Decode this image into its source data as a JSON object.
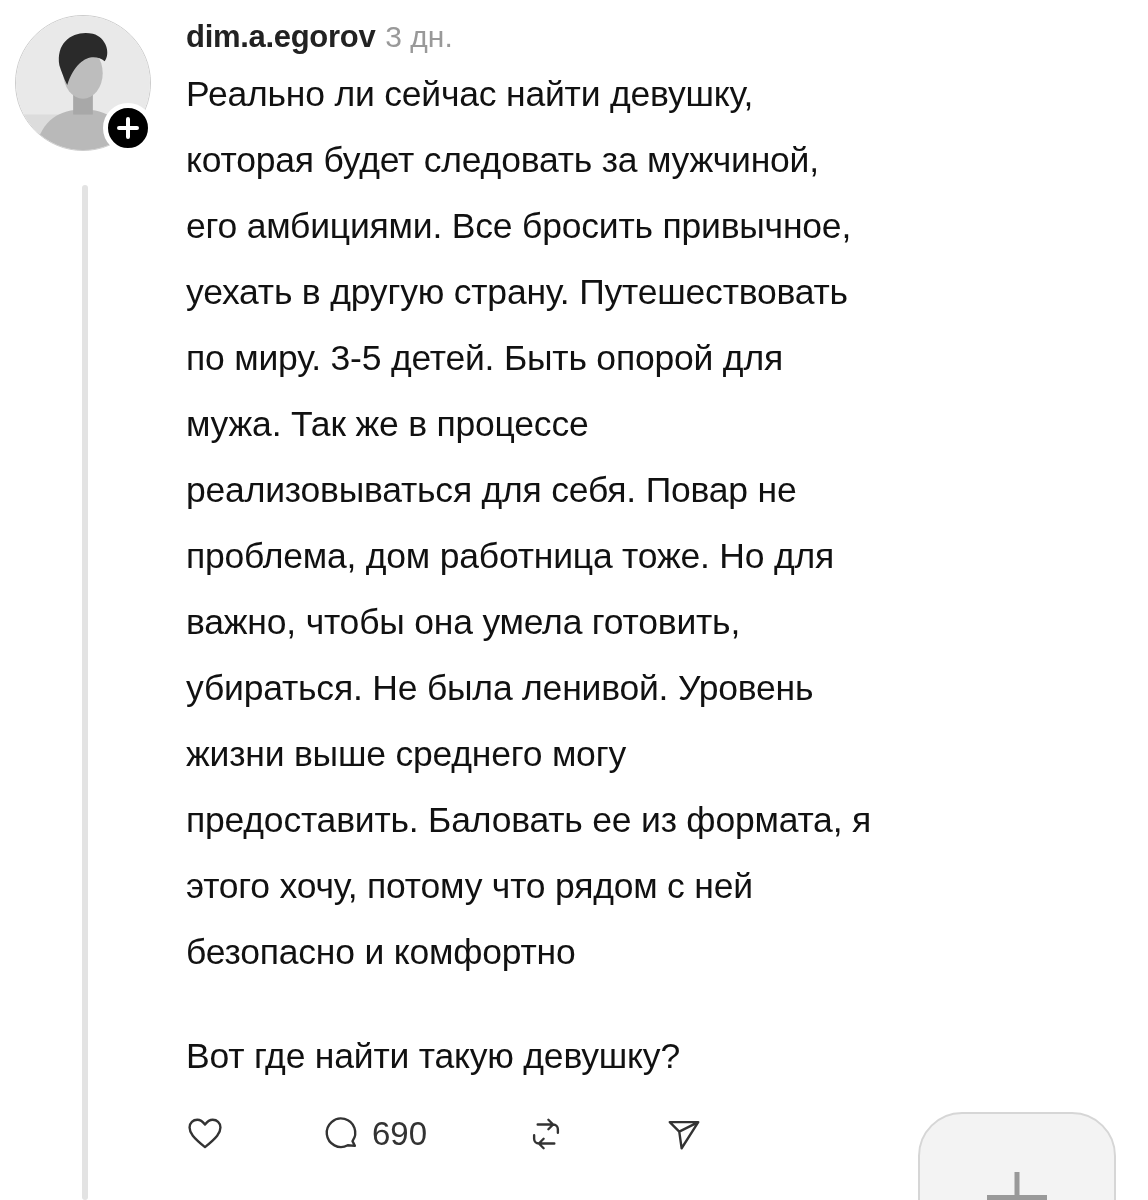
{
  "post": {
    "username": "dim.a.egorov",
    "time": "3 дн.",
    "paragraphs": [
      "Реально ли сейчас найти девушку,\nкоторая будет следовать за мужчиной,\nего амбициями. Все бросить привычное,\nуехать в другую страну. Путешествовать\nпо миру. 3-5 детей. Быть опорой для\nмужа. Так же в процессе\nреализовываться для себя. Повар не\nпроблема, дом работница тоже. Но для\nважно, чтобы она умела готовить,\nубираться. Не была ленивой. Уровень\nжизни выше среднего могу\nпредоставить. Баловать ее из формата, я\nэтого хочу, потому что рядом с ней\nбезопасно и комфортно",
      "Вот где найти такую девушку?"
    ],
    "actions": [
      {
        "kind": "like"
      },
      {
        "kind": "reply",
        "count": "690"
      },
      {
        "kind": "repost"
      },
      {
        "kind": "share"
      }
    ]
  }
}
